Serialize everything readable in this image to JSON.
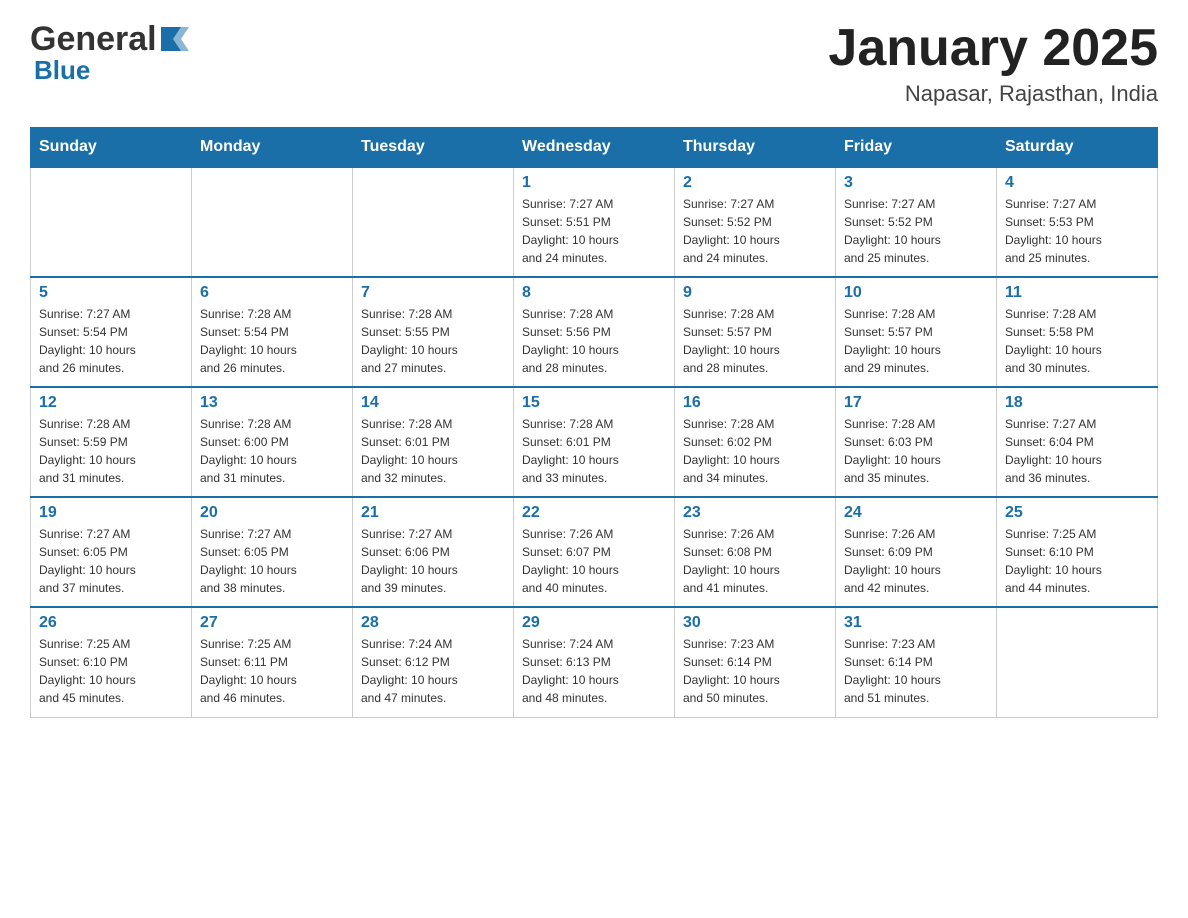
{
  "header": {
    "logo_general": "General",
    "logo_blue": "Blue",
    "month_title": "January 2025",
    "location": "Napasar, Rajasthan, India"
  },
  "days_of_week": [
    "Sunday",
    "Monday",
    "Tuesday",
    "Wednesday",
    "Thursday",
    "Friday",
    "Saturday"
  ],
  "weeks": [
    {
      "days": [
        {
          "number": "",
          "info": ""
        },
        {
          "number": "",
          "info": ""
        },
        {
          "number": "",
          "info": ""
        },
        {
          "number": "1",
          "info": "Sunrise: 7:27 AM\nSunset: 5:51 PM\nDaylight: 10 hours\nand 24 minutes."
        },
        {
          "number": "2",
          "info": "Sunrise: 7:27 AM\nSunset: 5:52 PM\nDaylight: 10 hours\nand 24 minutes."
        },
        {
          "number": "3",
          "info": "Sunrise: 7:27 AM\nSunset: 5:52 PM\nDaylight: 10 hours\nand 25 minutes."
        },
        {
          "number": "4",
          "info": "Sunrise: 7:27 AM\nSunset: 5:53 PM\nDaylight: 10 hours\nand 25 minutes."
        }
      ]
    },
    {
      "days": [
        {
          "number": "5",
          "info": "Sunrise: 7:27 AM\nSunset: 5:54 PM\nDaylight: 10 hours\nand 26 minutes."
        },
        {
          "number": "6",
          "info": "Sunrise: 7:28 AM\nSunset: 5:54 PM\nDaylight: 10 hours\nand 26 minutes."
        },
        {
          "number": "7",
          "info": "Sunrise: 7:28 AM\nSunset: 5:55 PM\nDaylight: 10 hours\nand 27 minutes."
        },
        {
          "number": "8",
          "info": "Sunrise: 7:28 AM\nSunset: 5:56 PM\nDaylight: 10 hours\nand 28 minutes."
        },
        {
          "number": "9",
          "info": "Sunrise: 7:28 AM\nSunset: 5:57 PM\nDaylight: 10 hours\nand 28 minutes."
        },
        {
          "number": "10",
          "info": "Sunrise: 7:28 AM\nSunset: 5:57 PM\nDaylight: 10 hours\nand 29 minutes."
        },
        {
          "number": "11",
          "info": "Sunrise: 7:28 AM\nSunset: 5:58 PM\nDaylight: 10 hours\nand 30 minutes."
        }
      ]
    },
    {
      "days": [
        {
          "number": "12",
          "info": "Sunrise: 7:28 AM\nSunset: 5:59 PM\nDaylight: 10 hours\nand 31 minutes."
        },
        {
          "number": "13",
          "info": "Sunrise: 7:28 AM\nSunset: 6:00 PM\nDaylight: 10 hours\nand 31 minutes."
        },
        {
          "number": "14",
          "info": "Sunrise: 7:28 AM\nSunset: 6:01 PM\nDaylight: 10 hours\nand 32 minutes."
        },
        {
          "number": "15",
          "info": "Sunrise: 7:28 AM\nSunset: 6:01 PM\nDaylight: 10 hours\nand 33 minutes."
        },
        {
          "number": "16",
          "info": "Sunrise: 7:28 AM\nSunset: 6:02 PM\nDaylight: 10 hours\nand 34 minutes."
        },
        {
          "number": "17",
          "info": "Sunrise: 7:28 AM\nSunset: 6:03 PM\nDaylight: 10 hours\nand 35 minutes."
        },
        {
          "number": "18",
          "info": "Sunrise: 7:27 AM\nSunset: 6:04 PM\nDaylight: 10 hours\nand 36 minutes."
        }
      ]
    },
    {
      "days": [
        {
          "number": "19",
          "info": "Sunrise: 7:27 AM\nSunset: 6:05 PM\nDaylight: 10 hours\nand 37 minutes."
        },
        {
          "number": "20",
          "info": "Sunrise: 7:27 AM\nSunset: 6:05 PM\nDaylight: 10 hours\nand 38 minutes."
        },
        {
          "number": "21",
          "info": "Sunrise: 7:27 AM\nSunset: 6:06 PM\nDaylight: 10 hours\nand 39 minutes."
        },
        {
          "number": "22",
          "info": "Sunrise: 7:26 AM\nSunset: 6:07 PM\nDaylight: 10 hours\nand 40 minutes."
        },
        {
          "number": "23",
          "info": "Sunrise: 7:26 AM\nSunset: 6:08 PM\nDaylight: 10 hours\nand 41 minutes."
        },
        {
          "number": "24",
          "info": "Sunrise: 7:26 AM\nSunset: 6:09 PM\nDaylight: 10 hours\nand 42 minutes."
        },
        {
          "number": "25",
          "info": "Sunrise: 7:25 AM\nSunset: 6:10 PM\nDaylight: 10 hours\nand 44 minutes."
        }
      ]
    },
    {
      "days": [
        {
          "number": "26",
          "info": "Sunrise: 7:25 AM\nSunset: 6:10 PM\nDaylight: 10 hours\nand 45 minutes."
        },
        {
          "number": "27",
          "info": "Sunrise: 7:25 AM\nSunset: 6:11 PM\nDaylight: 10 hours\nand 46 minutes."
        },
        {
          "number": "28",
          "info": "Sunrise: 7:24 AM\nSunset: 6:12 PM\nDaylight: 10 hours\nand 47 minutes."
        },
        {
          "number": "29",
          "info": "Sunrise: 7:24 AM\nSunset: 6:13 PM\nDaylight: 10 hours\nand 48 minutes."
        },
        {
          "number": "30",
          "info": "Sunrise: 7:23 AM\nSunset: 6:14 PM\nDaylight: 10 hours\nand 50 minutes."
        },
        {
          "number": "31",
          "info": "Sunrise: 7:23 AM\nSunset: 6:14 PM\nDaylight: 10 hours\nand 51 minutes."
        },
        {
          "number": "",
          "info": ""
        }
      ]
    }
  ]
}
